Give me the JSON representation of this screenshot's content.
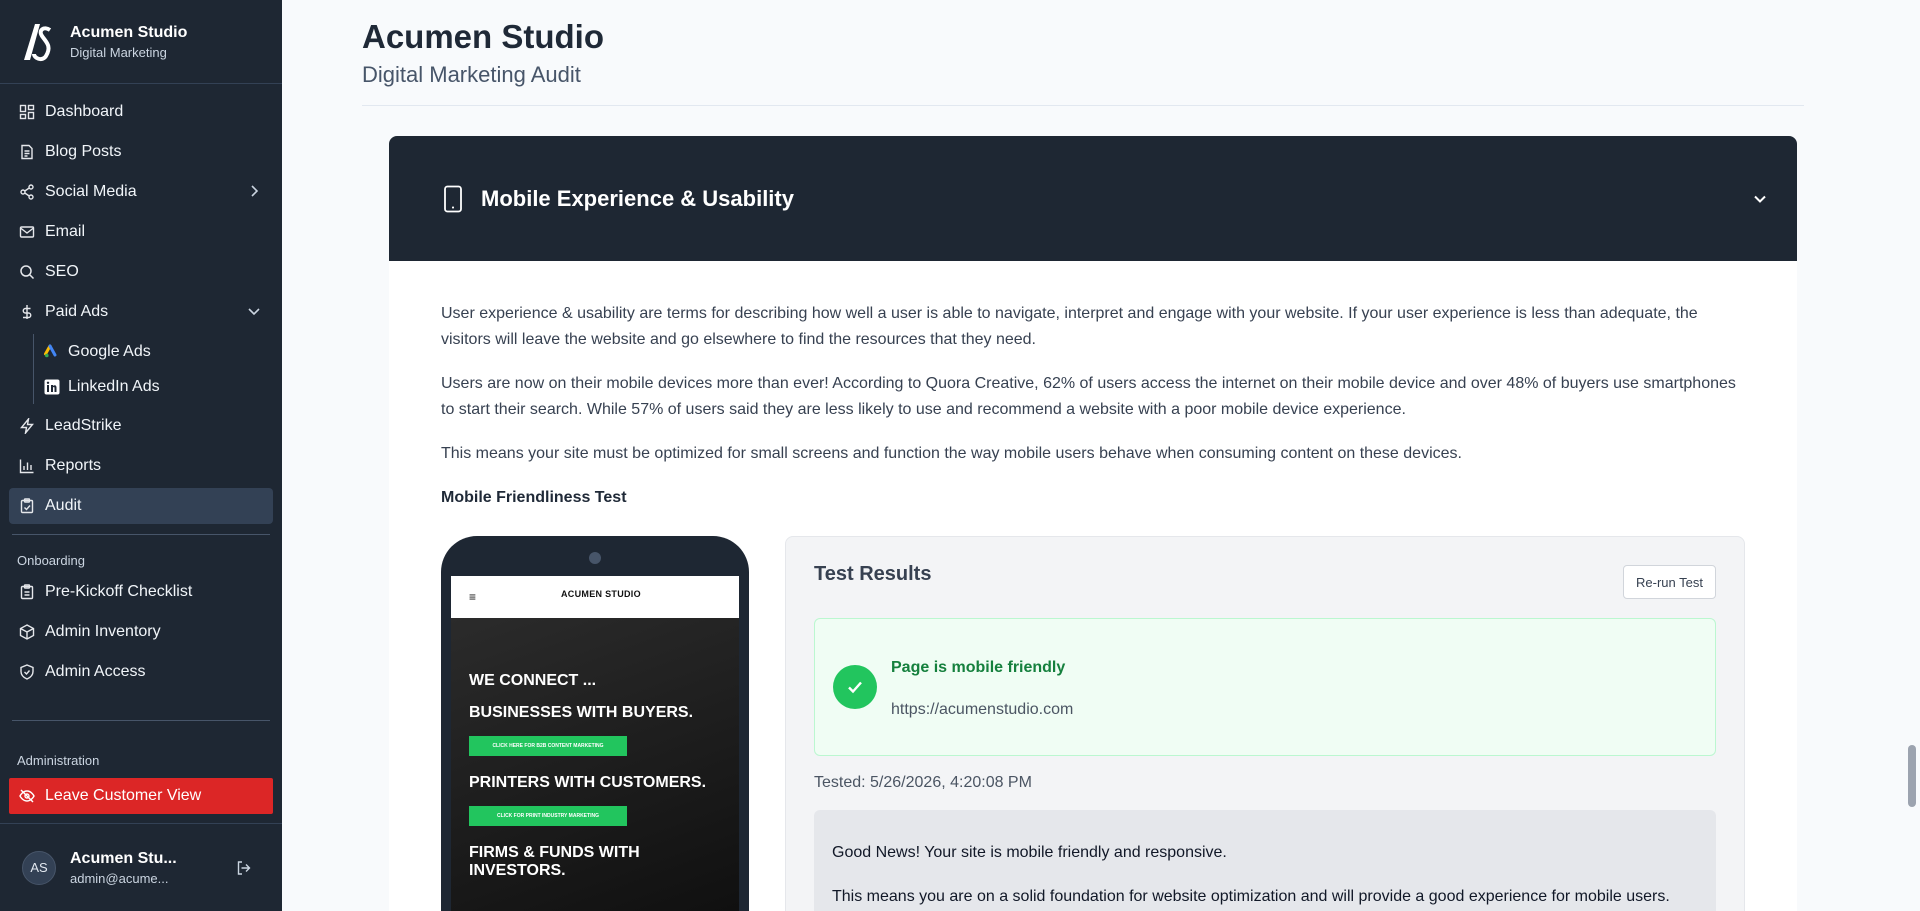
{
  "brand": {
    "name": "Acumen Studio",
    "subtitle": "Digital Marketing"
  },
  "nav": {
    "dashboard": "Dashboard",
    "blog_posts": "Blog Posts",
    "social_media": "Social Media",
    "email": "Email",
    "seo": "SEO",
    "paid_ads": "Paid Ads",
    "google_ads": "Google Ads",
    "linkedin_ads": "LinkedIn Ads",
    "leadstrike": "LeadStrike",
    "reports": "Reports",
    "audit": "Audit"
  },
  "onboarding": {
    "label": "Onboarding",
    "pre_kickoff": "Pre-Kickoff Checklist",
    "admin_inventory": "Admin Inventory",
    "admin_access": "Admin Access"
  },
  "administration": {
    "label": "Administration",
    "leave_customer_view": "Leave Customer View"
  },
  "user": {
    "initials": "AS",
    "name": "Acumen Stu...",
    "email": "admin@acume..."
  },
  "page": {
    "title": "Acumen Studio",
    "subtitle": "Digital Marketing Audit"
  },
  "section": {
    "title": "Mobile Experience & Usability",
    "para1": "User experience & usability are terms for describing how well a user is able to navigate, interpret and engage with your website. If your user experience is less than adequate, the visitors will leave the website and go elsewhere to find the resources that they need.",
    "para2": "Users are now on their mobile devices more than ever! According to Quora Creative, 62% of users access the internet on their mobile device and over 48% of buyers use smartphones to start their search. While 57% of users said they are less likely to use and recommend a website with a poor mobile device experience.",
    "para3": "This means your site must be optimized for small screens and function the way mobile users behave when consuming content on these devices.",
    "test_heading": "Mobile Friendliness Test"
  },
  "phone_preview": {
    "menu": "≡",
    "brand": "ACUMEN STUDIO",
    "line1": "WE CONNECT ...",
    "line2": "BUSINESSES WITH BUYERS.",
    "cta1": "CLICK HERE FOR B2B CONTENT MARKETING",
    "line3": "PRINTERS WITH CUSTOMERS.",
    "cta2": "CLICK FOR PRINT INDUSTRY MARKETING",
    "line4": "FIRMS & FUNDS WITH INVESTORS."
  },
  "results": {
    "title": "Test Results",
    "rerun": "Re-run Test",
    "status": "Page is mobile friendly",
    "url": "https://acumenstudio.com",
    "tested": "Tested: 5/26/2026, 4:20:08 PM",
    "news_title": "Good News! Your site is mobile friendly and responsive.",
    "news_body": "This means you are on a solid foundation for website optimization and will provide a good experience for mobile users."
  },
  "colors": {
    "sidebar": "#1e2733",
    "danger": "#dc2626",
    "success": "#22c55e"
  }
}
